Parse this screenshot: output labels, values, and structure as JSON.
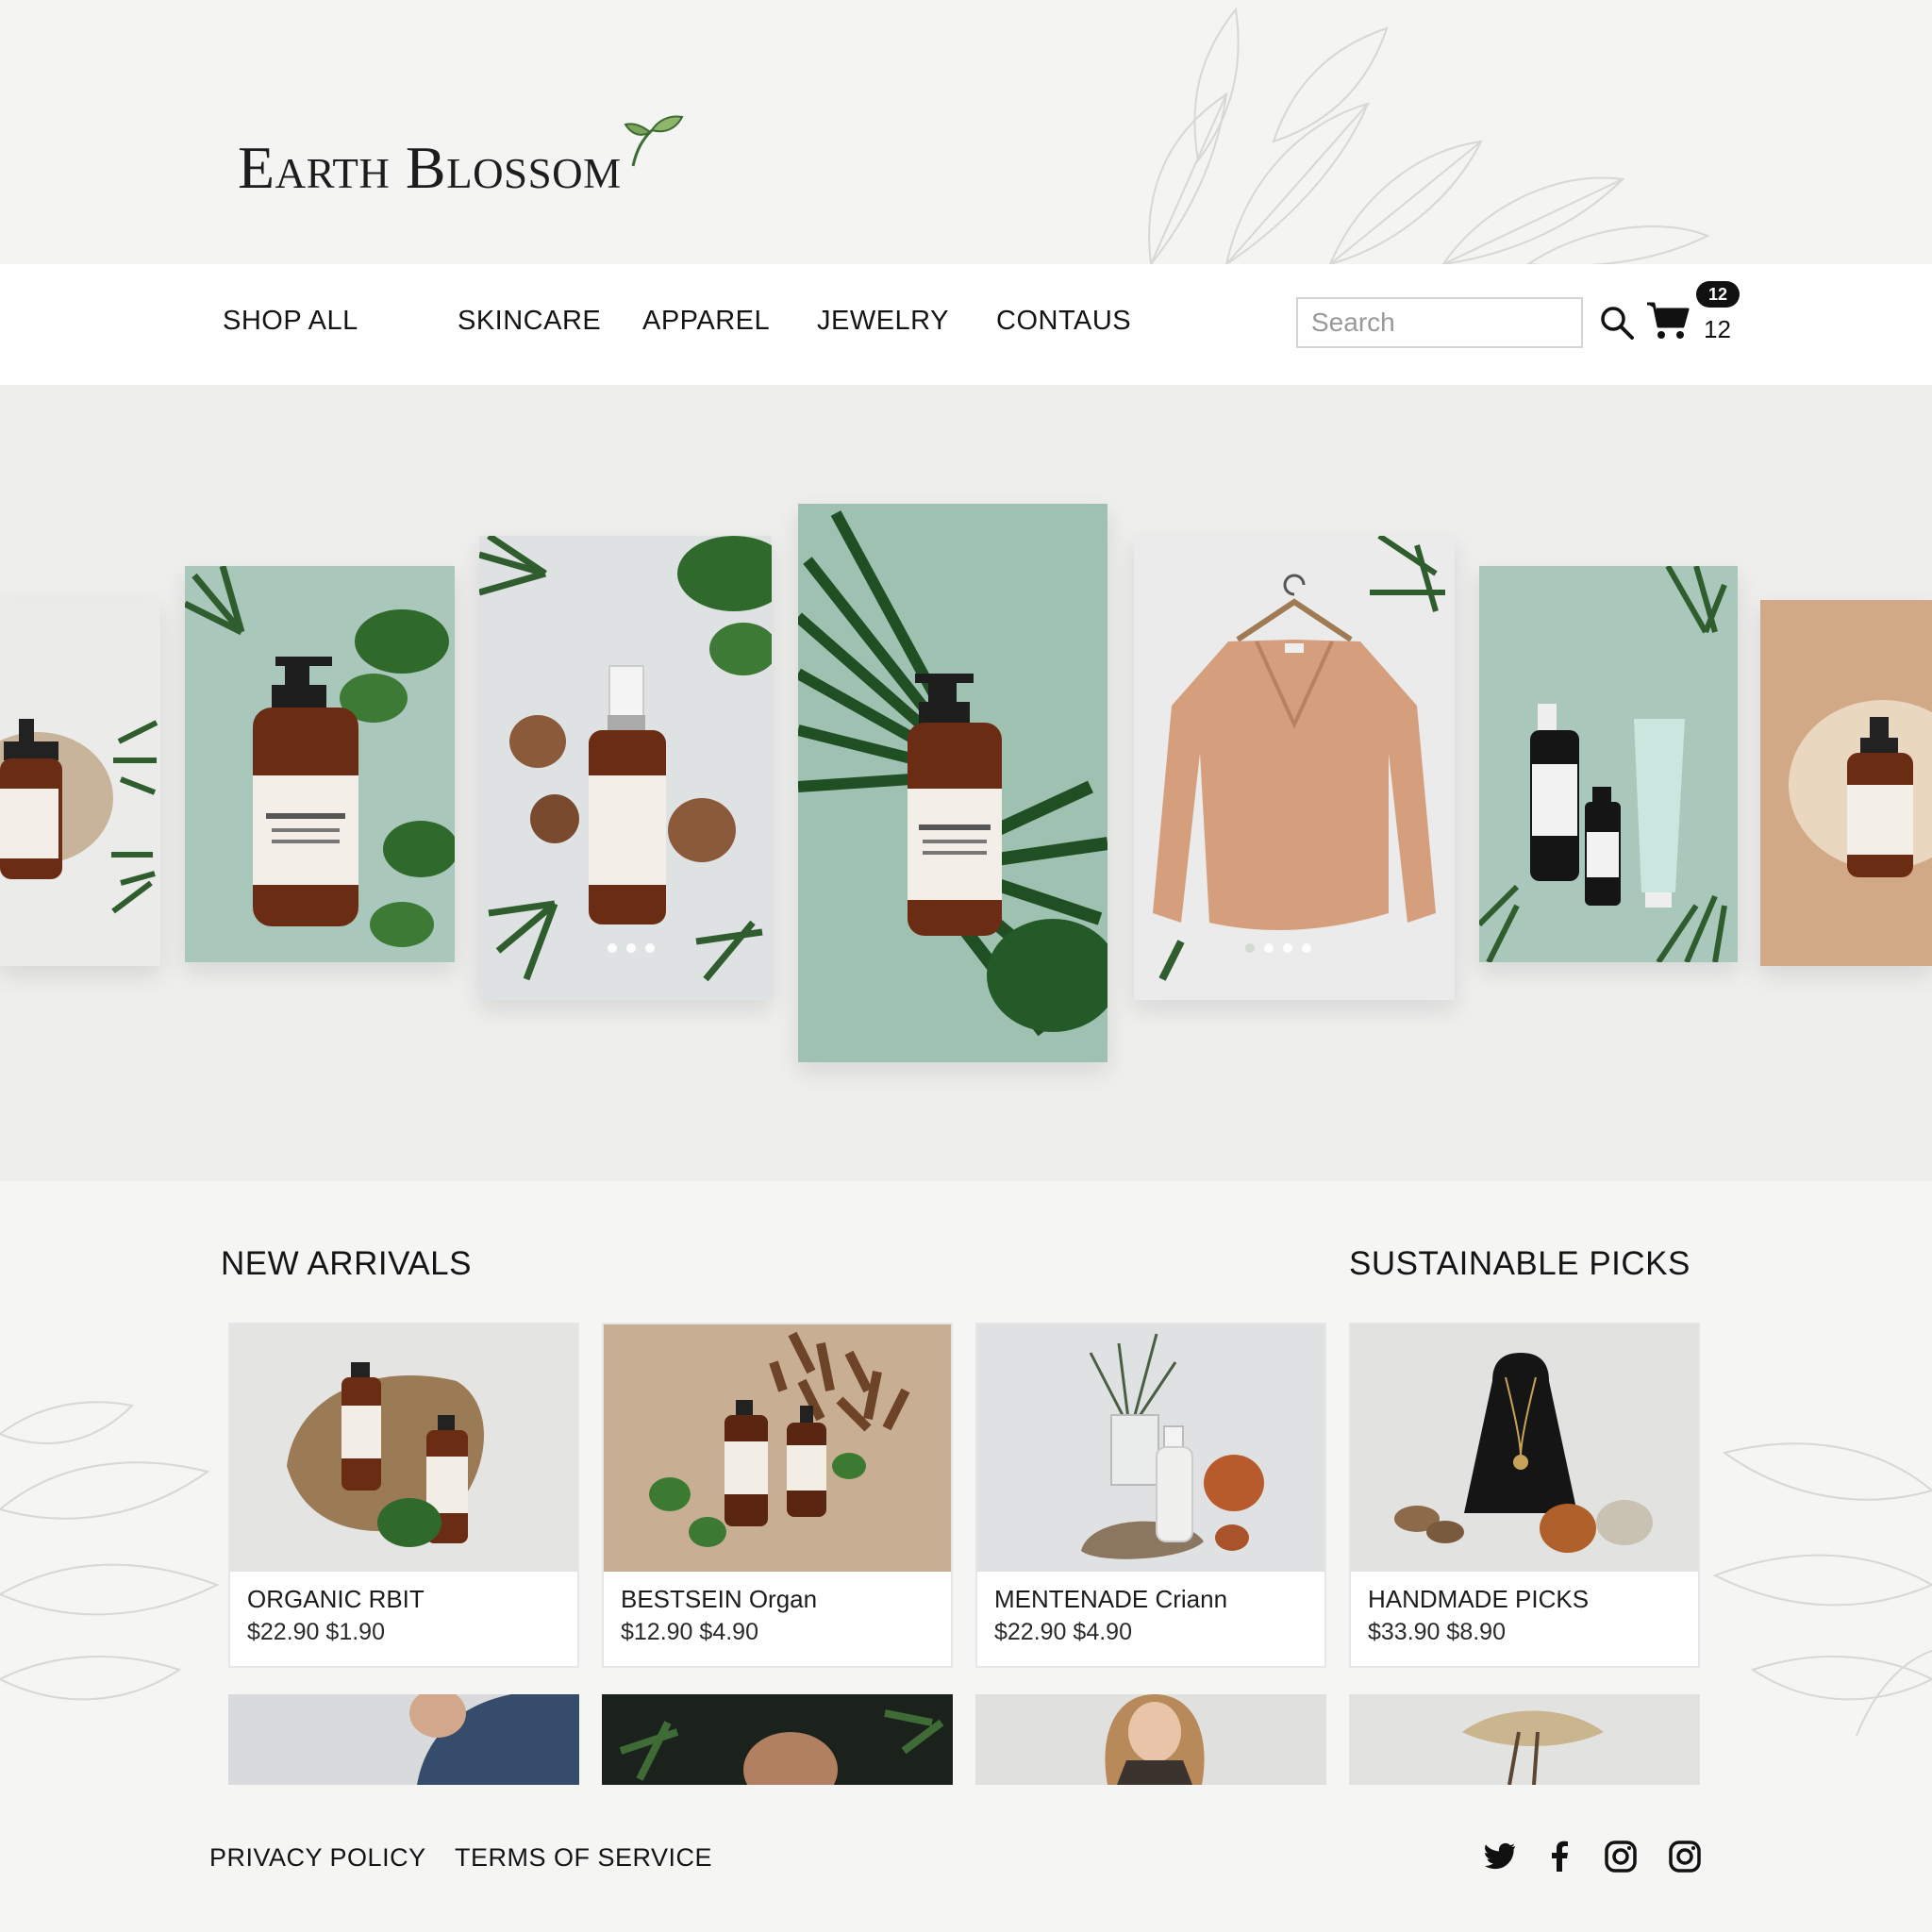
{
  "brand": {
    "name": "Earth Blossom"
  },
  "nav": {
    "items": [
      "SHOP ALL",
      "SKINCARE",
      "APPAREL",
      "JEWELRY",
      "CONTAUS"
    ],
    "search_placeholder": "Search",
    "cart_badge": "12",
    "cart_count": "12"
  },
  "colors": {
    "sage": "#9fc1b2",
    "sage_light": "#a9c7ba",
    "leaf_green": "#2f5d2e",
    "amber": "#6b2c14",
    "tan": "#d2a987",
    "sweater": "#d59f7e"
  },
  "sections": {
    "new_arrivals": "NEW ARRIVALS",
    "sustainable_picks": "SUSTAINABLE PICKS"
  },
  "products": [
    {
      "name": "ORGANIC RBIT",
      "price": "$22.90 $1.90"
    },
    {
      "name": "BESTSEIN Organ",
      "price": "$12.90 $4.90"
    },
    {
      "name": "MENTENADE Criann",
      "price": "$22.90 $4.90"
    },
    {
      "name": "HANDMADE PICKS",
      "price": "$33.90 $8.90"
    }
  ],
  "footer": {
    "links": [
      "PRIVACY POLICY",
      "TERMS OF SERVICE"
    ],
    "social_icons": [
      "twitter-icon",
      "facebook-icon",
      "instagram-icon",
      "instagram-icon"
    ]
  }
}
